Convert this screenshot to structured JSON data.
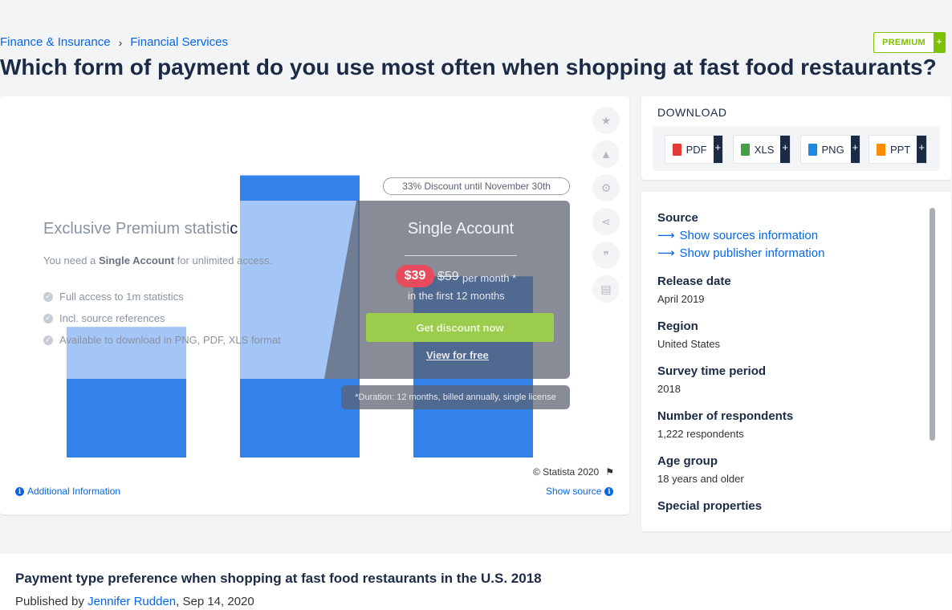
{
  "breadcrumb": {
    "items": [
      "Finance & Insurance",
      "Financial Services"
    ],
    "separator": "›"
  },
  "premium_badge": {
    "label": "PREMIUM",
    "plus": "+"
  },
  "page_title": "Which form of payment do you use most often when shopping at fast food restaurants?",
  "paywall": {
    "title_part1": "Exclusive Premium statisti",
    "title_part2": "c",
    "subtitle_pre": "You need a ",
    "subtitle_bold": "Single Account",
    "subtitle_post": " for unlimited access.",
    "features": [
      "Full access to 1m statistics",
      "Incl. source references",
      "Available to download in PNG, PDF, XLS format"
    ],
    "plan_title": "Single Account",
    "price_new": "$39",
    "price_old": "$59",
    "price_per": "per month *",
    "price_note": "in the first 12 months",
    "cta": "Get discount now",
    "free_link": "View for free",
    "discount": "33% Discount until November 30th",
    "duration": "*Duration: 12 months, billed annually, single license"
  },
  "chart_footer": {
    "copyright": "© Statista 2020",
    "additional_info": "Additional Information",
    "show_source": "Show source"
  },
  "chart_data": {
    "type": "bar",
    "categories": [
      "",
      "",
      ""
    ],
    "values": [
      44,
      95,
      61
    ],
    "title": "",
    "xlabel": "",
    "ylabel": "",
    "colors": [
      "#0666e5"
    ]
  },
  "tools": [
    "star-icon",
    "bell-icon",
    "gear-icon",
    "share-icon",
    "quote-icon",
    "print-icon"
  ],
  "download": {
    "heading": "DOWNLOAD",
    "buttons": [
      {
        "label": "PDF",
        "plus": "+",
        "color": "#e53935"
      },
      {
        "label": "XLS",
        "plus": "+",
        "color": "#43a047"
      },
      {
        "label": "PNG",
        "plus": "+",
        "color": "#1e88e5"
      },
      {
        "label": "PPT",
        "plus": "+",
        "color": "#fb8c00"
      }
    ]
  },
  "meta": {
    "source_label": "Source",
    "show_sources": "Show sources information",
    "show_publisher": "Show publisher information",
    "release_label": "Release date",
    "release_value": "April 2019",
    "region_label": "Region",
    "region_value": "United States",
    "survey_label": "Survey time period",
    "survey_value": "2018",
    "respondents_label": "Number of respondents",
    "respondents_value": "1,222 respondents",
    "age_label": "Age group",
    "age_value": "18 years and older",
    "special_label": "Special properties"
  },
  "bottom": {
    "title": "Payment type preference when shopping at fast food restaurants in the U.S. 2018",
    "published_prefix": "Published by ",
    "author": "Jennifer Rudden",
    "date": ", Sep 14, 2020"
  }
}
